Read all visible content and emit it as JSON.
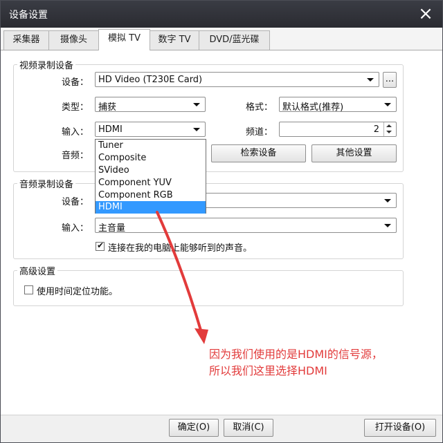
{
  "window": {
    "title": "设备设置",
    "close_icon": "×"
  },
  "tabs": [
    {
      "label": "采集器",
      "active": false
    },
    {
      "label": "摄像头",
      "active": false
    },
    {
      "label": "模拟 TV",
      "active": true
    },
    {
      "label": "数字 TV",
      "active": false
    },
    {
      "label": "DVD/蓝光碟",
      "active": false
    }
  ],
  "video_group": {
    "title": "视频录制设备",
    "device_label": "设备：",
    "device_value": "HD Video (T230E Card)",
    "browse_label": "...",
    "type_label": "类型：",
    "type_value": "捕获",
    "format_label": "格式：",
    "format_value": "默认格式(推荐)",
    "input_label": "输入：",
    "input_value": "HDMI",
    "channel_label": "频道：",
    "channel_value": "2",
    "audio_label": "音频：",
    "search_button": "检索设备",
    "other_button": "其他设置"
  },
  "input_dropdown": {
    "options": [
      "Tuner",
      "Composite",
      "SVideo",
      "Component YUV",
      "Component RGB",
      "HDMI"
    ],
    "selected": "HDMI"
  },
  "audio_group": {
    "title": "音频录制设备",
    "device_label": "设备：",
    "input_label": "输入：",
    "input_value": "主音量",
    "listen_checkbox_label": "连接在我的电脑上能够听到的声音。",
    "listen_checked": true
  },
  "advanced_group": {
    "title": "高级设置",
    "timeshift_label": "使用时间定位功能。",
    "timeshift_checked": false
  },
  "annotation": {
    "line1": "因为我们使用的是HDMI的信号源，",
    "line2": "所以我们这里选择HDMI",
    "color": "#e23b3b"
  },
  "footer": {
    "ok_button": "确定(O)",
    "cancel_button": "取消(C)",
    "open_device_button": "打开设备(O)"
  },
  "colors": {
    "titlebar": "#2f3036",
    "selection": "#3399ff",
    "annotation_arrow": "#e23b3b"
  }
}
